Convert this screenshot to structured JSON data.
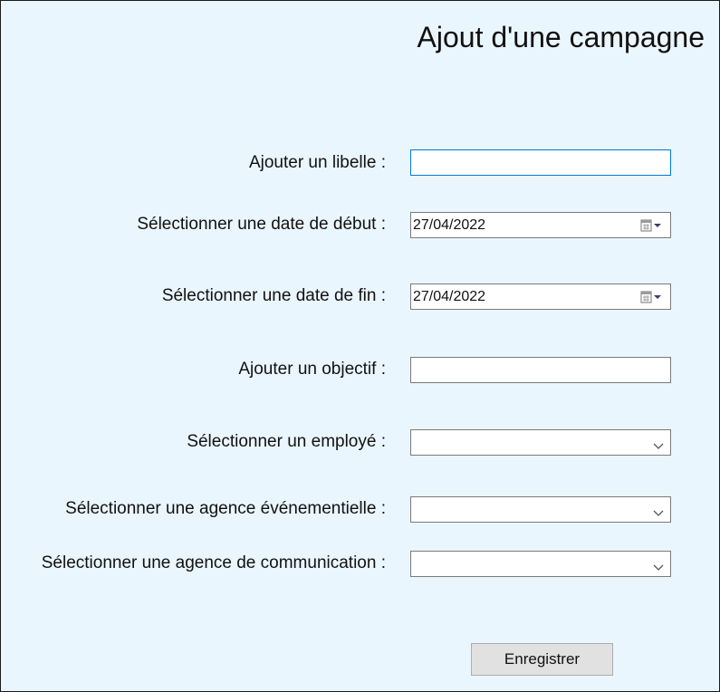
{
  "form": {
    "title": "Ajout d'une campagne",
    "libelle": {
      "label": "Ajouter un libelle :",
      "value": ""
    },
    "date_debut": {
      "label": "Sélectionner une date de début :",
      "value": "27/04/2022",
      "icon": "calendar-dropdown-icon"
    },
    "date_fin": {
      "label": "Sélectionner une date de fin :",
      "value": "27/04/2022",
      "icon": "calendar-dropdown-icon"
    },
    "objectif": {
      "label": "Ajouter un objectif :",
      "value": ""
    },
    "employe": {
      "label": "Sélectionner un employé :",
      "value": "",
      "icon": "chevron-down-icon"
    },
    "agence_evenementielle": {
      "label": "Sélectionner une agence événementielle :",
      "value": "",
      "icon": "chevron-down-icon"
    },
    "agence_communication": {
      "label": "Sélectionner une agence de communication :",
      "value": "",
      "icon": "chevron-down-icon"
    },
    "save_label": "Enregistrer"
  },
  "colors": {
    "background": "#eaf6fd",
    "focus_border": "#0078d7",
    "field_border": "#7a7a7a",
    "button_bg": "#e1e1e1"
  }
}
